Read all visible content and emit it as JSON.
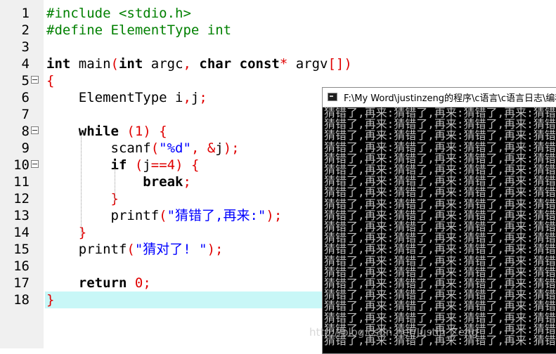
{
  "editor": {
    "current_line": 18,
    "lines": [
      {
        "n": "1",
        "tokens": [
          {
            "t": "#include <stdio.h>",
            "c": "pp"
          }
        ]
      },
      {
        "n": "2",
        "tokens": [
          {
            "t": "#define ElementType int",
            "c": "pp"
          }
        ]
      },
      {
        "n": "3",
        "tokens": []
      },
      {
        "n": "4",
        "tokens": [
          {
            "t": "int",
            "c": "kw"
          },
          {
            "t": " main",
            "c": "fn"
          },
          {
            "t": "(",
            "c": "op"
          },
          {
            "t": "int",
            "c": "kw"
          },
          {
            "t": " argc",
            "c": "id"
          },
          {
            "t": ", ",
            "c": "op"
          },
          {
            "t": "char",
            "c": "kw"
          },
          {
            "t": " ",
            "c": "id"
          },
          {
            "t": "const",
            "c": "kw"
          },
          {
            "t": "*",
            "c": "op"
          },
          {
            "t": " argv",
            "c": "id"
          },
          {
            "t": "[])",
            "c": "op"
          }
        ]
      },
      {
        "n": "5",
        "fold": true,
        "tokens": [
          {
            "t": "{",
            "c": "op"
          }
        ]
      },
      {
        "n": "6",
        "tokens": [
          {
            "t": "    ElementType i",
            "c": "id"
          },
          {
            "t": ",",
            "c": "op"
          },
          {
            "t": "j",
            "c": "id"
          },
          {
            "t": ";",
            "c": "op"
          }
        ]
      },
      {
        "n": "7",
        "tokens": []
      },
      {
        "n": "8",
        "fold": true,
        "tokens": [
          {
            "t": "    ",
            "c": "id"
          },
          {
            "t": "while",
            "c": "kw"
          },
          {
            "t": " (",
            "c": "op"
          },
          {
            "t": "1",
            "c": "num"
          },
          {
            "t": ") {",
            "c": "op"
          }
        ]
      },
      {
        "n": "9",
        "tokens": [
          {
            "t": "        scanf",
            "c": "fn"
          },
          {
            "t": "(",
            "c": "op"
          },
          {
            "t": "\"%d\"",
            "c": "str"
          },
          {
            "t": ", &",
            "c": "op"
          },
          {
            "t": "j",
            "c": "id"
          },
          {
            "t": ");",
            "c": "op"
          }
        ]
      },
      {
        "n": "10",
        "fold": true,
        "tokens": [
          {
            "t": "        ",
            "c": "id"
          },
          {
            "t": "if",
            "c": "kw"
          },
          {
            "t": " (",
            "c": "op"
          },
          {
            "t": "j",
            "c": "id"
          },
          {
            "t": "==",
            "c": "op"
          },
          {
            "t": "4",
            "c": "num"
          },
          {
            "t": ") {",
            "c": "op"
          }
        ]
      },
      {
        "n": "11",
        "tokens": [
          {
            "t": "            ",
            "c": "id"
          },
          {
            "t": "break",
            "c": "kw"
          },
          {
            "t": ";",
            "c": "op"
          }
        ]
      },
      {
        "n": "12",
        "tokens": [
          {
            "t": "        }",
            "c": "op"
          }
        ]
      },
      {
        "n": "13",
        "tokens": [
          {
            "t": "        printf",
            "c": "fn"
          },
          {
            "t": "(",
            "c": "op"
          },
          {
            "t": "\"猜错了,再来:\"",
            "c": "str"
          },
          {
            "t": ");",
            "c": "op"
          }
        ]
      },
      {
        "n": "14",
        "tokens": [
          {
            "t": "    }",
            "c": "op"
          }
        ]
      },
      {
        "n": "15",
        "tokens": [
          {
            "t": "    printf",
            "c": "fn"
          },
          {
            "t": "(",
            "c": "op"
          },
          {
            "t": "\"猜对了! \"",
            "c": "str"
          },
          {
            "t": ");",
            "c": "op"
          }
        ]
      },
      {
        "n": "16",
        "tokens": []
      },
      {
        "n": "17",
        "tokens": [
          {
            "t": "    ",
            "c": "id"
          },
          {
            "t": "return",
            "c": "kw"
          },
          {
            "t": " ",
            "c": "id"
          },
          {
            "t": "0",
            "c": "num"
          },
          {
            "t": ";",
            "c": "op"
          }
        ]
      },
      {
        "n": "18",
        "tokens": [
          {
            "t": "}",
            "c": "op"
          }
        ]
      }
    ]
  },
  "console": {
    "title": "F:\\My Word\\justinzeng的程序\\c语言\\c语言日志\\编程日",
    "line_text": "猜错了,再来:猜错了,再来:猜错了,再来:猜错了,再来:猜错了,再来:",
    "line_count": 21
  },
  "watermark": "http://blog.csdn.net/Justin_Zeng"
}
